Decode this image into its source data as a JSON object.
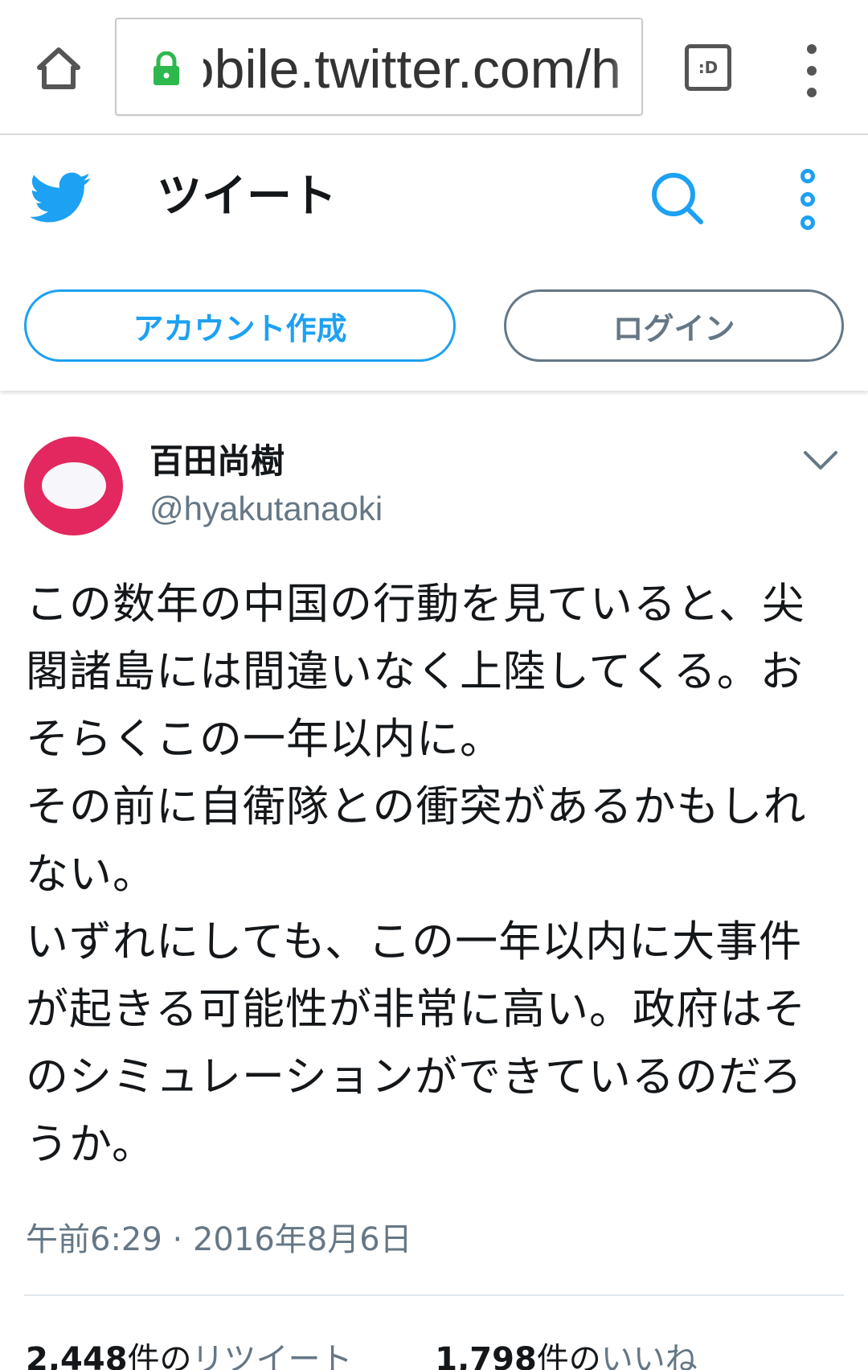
{
  "browser": {
    "url": "mobile.twitter.com/h",
    "reader_icon_text": ":D",
    "icons": {
      "home": "home-icon",
      "lock": "lock-icon",
      "reader": "reader-mode-icon",
      "menu": "overflow-menu-icon"
    }
  },
  "header": {
    "title": "ツイート",
    "signup_label": "アカウント作成",
    "login_label": "ログイン",
    "colors": {
      "accent": "#1da1f2",
      "secondary": "#657786"
    }
  },
  "tweet": {
    "author_name": "百田尚樹",
    "author_handle": "@hyakutanaoki",
    "avatar_color": "#e2285e",
    "text_lines": [
      "この数年の中国の行動を見ていると、尖",
      "閣諸島には間違いなく上陸してくる。お",
      "そらくこの一年以内に。",
      "その前に自衛隊との衝突があるかもしれ",
      "ない。",
      "いずれにしても、この一年以内に大事件",
      "が起きる可能性が非常に高い。政府はそ",
      "のシミュレーションができているのだろ",
      "うか。"
    ],
    "timestamp": "午前6:29 · 2016年8月6日",
    "retweets": {
      "count": "2,448",
      "unit": "件の",
      "label": "リツイート"
    },
    "likes": {
      "count": "1,798",
      "unit": "件の",
      "label": "いいね"
    }
  }
}
